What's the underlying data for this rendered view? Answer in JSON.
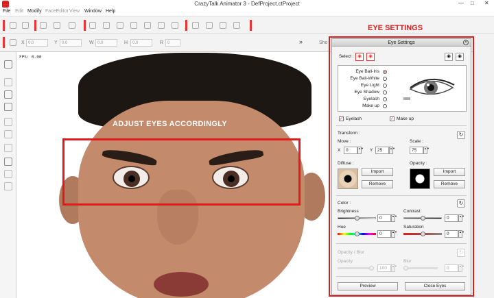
{
  "window": {
    "title": "CrazyTalk Animator 3 - DefProject.ctProject",
    "controls": [
      "—",
      "□",
      "✕"
    ]
  },
  "menu": [
    "File",
    "Edit",
    "Modify",
    "FaceEditor",
    "View",
    "Window",
    "Help"
  ],
  "transform_bar": {
    "x_label": "X",
    "x_value": "0.0",
    "y_label": "Y",
    "y_value": "0.0",
    "w_label": "W",
    "w_value": "0.0",
    "h_label": "H",
    "h_value": "0.0",
    "r_label": "R",
    "r_value": "0",
    "more": "»",
    "show": "Sho"
  },
  "viewport": {
    "fps": "FPS: 0.00",
    "annotation": "ADJUST EYES ACCORDINGLY"
  },
  "annotation_title": "EYE SETTINGS",
  "panel": {
    "title": "Eye Settings",
    "select_label": "Select :",
    "parts": [
      {
        "label": "Eye Ball-Iris",
        "selected": true
      },
      {
        "label": "Eye Ball-White",
        "selected": false
      },
      {
        "label": "Eye Light",
        "selected": false
      },
      {
        "label": "Eye Shadow",
        "selected": false
      },
      {
        "label": "Eyelash",
        "selected": false
      },
      {
        "label": "Make up",
        "selected": false
      }
    ],
    "eyelash_checkbox": "Eyelash",
    "makeup_checkbox": "Make up",
    "transform_label": "Transform :",
    "move_label": "Move :",
    "move_x_label": "X",
    "move_x": "0",
    "move_y_label": "Y",
    "move_y": "25",
    "scale_label": "Scale :",
    "scale": "75",
    "diffuse_label": "Diffuse :",
    "opacity_label": "Opacity :",
    "import_label": "Import",
    "remove_label": "Remove",
    "color_label": "Color :",
    "brightness_label": "Brightness",
    "brightness": "0",
    "contrast_label": "Contrast",
    "contrast": "0",
    "hue_label": "Hue",
    "hue": "0",
    "saturation_label": "Saturation",
    "saturation": "0",
    "opacity_blur_label": "Opacity / Blur",
    "opacity_sub_label": "Opacity",
    "opacity_value": "100",
    "blur_label": "Blur",
    "blur_value": "0",
    "preview_button": "Preview",
    "close_eyes_button": "Close Eyes"
  },
  "colors": {
    "accent_red": "#e01a1a",
    "panel_bg": "#f4f4f4"
  }
}
